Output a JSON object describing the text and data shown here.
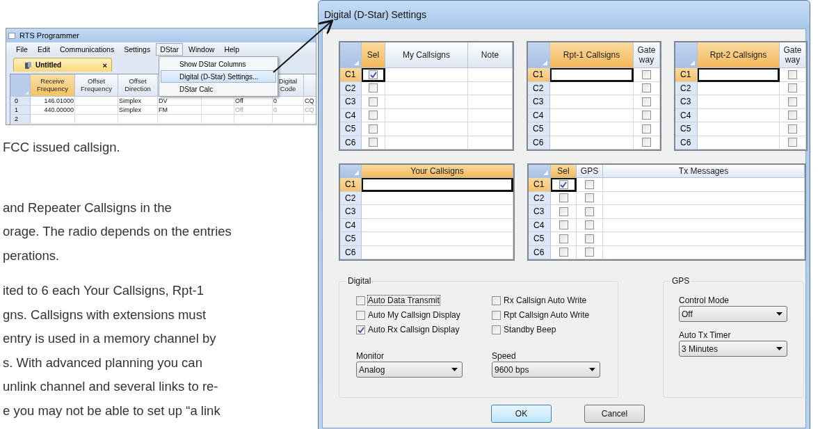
{
  "app_window": {
    "title": "RTS Programmer",
    "menu": [
      {
        "label": "File",
        "selected": false
      },
      {
        "label": "Edit",
        "selected": false
      },
      {
        "label": "Communications",
        "selected": false
      },
      {
        "label": "Settings",
        "selected": false
      },
      {
        "label": "DStar",
        "selected": true
      },
      {
        "label": "Window",
        "selected": false
      },
      {
        "label": "Help",
        "selected": false
      }
    ],
    "tab": {
      "label": "Untitled",
      "close": "×"
    },
    "dropdown": [
      {
        "label": "Show DStar Columns",
        "selected": false
      },
      {
        "label": "Digital (D-Star) Settings...",
        "selected": true
      },
      {
        "label": "DStar Calc",
        "selected": false
      }
    ],
    "grid": {
      "columns": [
        {
          "label": "Receive Frequency",
          "selected": true
        },
        {
          "label": "Offset Frequency",
          "selected": false
        },
        {
          "label": "Offset Direction",
          "selected": false
        },
        {},
        {},
        {},
        {
          "label": "Digital Code",
          "selected": false
        },
        {}
      ],
      "rows": [
        {
          "label": "0",
          "cells": [
            {
              "text": "146.01000",
              "disabled": false
            },
            null,
            {
              "text": "Simplex",
              "disabled": false
            },
            {
              "text": "DV",
              "disabled": false
            },
            null,
            {
              "text": "Off",
              "disabled": false
            },
            {
              "text": "0",
              "disabled": false
            },
            {
              "text": "CQ",
              "disabled": false
            }
          ]
        },
        {
          "label": "1",
          "cells": [
            {
              "text": "440.00000",
              "disabled": false
            },
            null,
            {
              "text": "Simplex",
              "disabled": false
            },
            {
              "text": "FM",
              "disabled": false
            },
            null,
            {
              "text": "Off",
              "disabled": true
            },
            {
              "text": "0",
              "disabled": true
            },
            {
              "text": "CQ",
              "disabled": true
            }
          ]
        },
        {
          "label": "2",
          "cells": []
        }
      ]
    }
  },
  "body_text": [
    [
      "FCC issued callsign."
    ],
    [
      "and Repeater Callsigns in the",
      "orage. The radio depends on the entries",
      "perations."
    ],
    [
      "ited to 6 each Your Callsigns, Rpt-1",
      "gns. Callsigns with extensions must",
      "entry is used in a memory channel by",
      "s. With advanced planning you can",
      "unlink channel and several links to re-",
      "e you may not be able to set up “a link"
    ]
  ],
  "dialog": {
    "title": "Digital (D-Star) Settings",
    "grids": [
      {
        "columns": [
          {
            "label": "Sel",
            "kind": "check",
            "selected": true
          },
          {
            "label": "My Callsigns",
            "kind": "text",
            "selected": false
          },
          {
            "label": "Note",
            "kind": "text",
            "selected": false
          }
        ],
        "rows": [
          {
            "label": "C1",
            "selected": true,
            "checked": [
              true
            ]
          },
          {
            "label": "C2",
            "selected": false,
            "checked": [
              false
            ]
          },
          {
            "label": "C3",
            "selected": false,
            "checked": [
              false
            ]
          },
          {
            "label": "C4",
            "selected": false,
            "checked": [
              false
            ]
          },
          {
            "label": "C5",
            "selected": false,
            "checked": [
              false
            ]
          },
          {
            "label": "C6",
            "selected": false,
            "checked": [
              false
            ]
          }
        ]
      },
      {
        "columns": [
          {
            "label": "Rpt-1 Callsigns",
            "kind": "text",
            "selected": true
          },
          {
            "label": "Gate way",
            "kind": "check",
            "selected": false
          }
        ],
        "rows": [
          {
            "label": "C1",
            "selected": true,
            "checked": [
              false
            ]
          },
          {
            "label": "C2",
            "selected": false,
            "checked": [
              false
            ]
          },
          {
            "label": "C3",
            "selected": false,
            "checked": [
              false
            ]
          },
          {
            "label": "C4",
            "selected": false,
            "checked": [
              false
            ]
          },
          {
            "label": "C5",
            "selected": false,
            "checked": [
              false
            ]
          },
          {
            "label": "C6",
            "selected": false,
            "checked": [
              false
            ]
          }
        ]
      },
      {
        "columns": [
          {
            "label": "Rpt-2 Callsigns",
            "kind": "text",
            "selected": true
          },
          {
            "label": "Gate way",
            "kind": "check",
            "selected": false
          }
        ],
        "rows": [
          {
            "label": "C1",
            "selected": true,
            "checked": [
              false
            ]
          },
          {
            "label": "C2",
            "selected": false,
            "checked": [
              false
            ]
          },
          {
            "label": "C3",
            "selected": false,
            "checked": [
              false
            ]
          },
          {
            "label": "C4",
            "selected": false,
            "checked": [
              false
            ]
          },
          {
            "label": "C5",
            "selected": false,
            "checked": [
              false
            ]
          },
          {
            "label": "C6",
            "selected": false,
            "checked": [
              false
            ]
          }
        ]
      },
      {
        "columns": [
          {
            "label": "Your Callsigns",
            "kind": "text",
            "selected": true
          }
        ],
        "rows": [
          {
            "label": "C1",
            "selected": true
          },
          {
            "label": "C2",
            "selected": false
          },
          {
            "label": "C3",
            "selected": false
          },
          {
            "label": "C4",
            "selected": false
          },
          {
            "label": "C5",
            "selected": false
          },
          {
            "label": "C6",
            "selected": false
          }
        ]
      },
      {
        "columns": [
          {
            "label": "Sel",
            "kind": "check",
            "selected": true
          },
          {
            "label": "GPS",
            "kind": "check",
            "selected": false
          },
          {
            "label": "Tx Messages",
            "kind": "text",
            "selected": false
          }
        ],
        "rows": [
          {
            "label": "C1",
            "selected": true,
            "checked": [
              true,
              false
            ]
          },
          {
            "label": "C2",
            "selected": false,
            "checked": [
              false,
              false
            ]
          },
          {
            "label": "C3",
            "selected": false,
            "checked": [
              false,
              false
            ]
          },
          {
            "label": "C4",
            "selected": false,
            "checked": [
              false,
              false
            ]
          },
          {
            "label": "C5",
            "selected": false,
            "checked": [
              false,
              false
            ]
          },
          {
            "label": "C6",
            "selected": false,
            "checked": [
              false,
              false
            ]
          }
        ]
      }
    ],
    "digital": {
      "legend": "Digital",
      "options": [
        {
          "label": "Auto Data Transmit",
          "checked": false,
          "focused": true
        },
        {
          "label": "Rx Callsign Auto Write",
          "checked": false,
          "focused": false
        },
        {
          "label": "Auto My Callsign Display",
          "checked": false,
          "focused": false
        },
        {
          "label": "Rpt Callsign Auto Write",
          "checked": false,
          "focused": false
        },
        {
          "label": "Auto Rx Callsign Display",
          "checked": true,
          "focused": false
        },
        {
          "label": "Standby Beep",
          "checked": false,
          "focused": false
        }
      ],
      "selects": [
        {
          "label": "Monitor",
          "value": "Analog"
        },
        {
          "label": "Speed",
          "value": "9600 bps"
        }
      ]
    },
    "gps": {
      "legend": "GPS",
      "selects": [
        {
          "label": "Control Mode",
          "value": "Off"
        },
        {
          "label": "Auto Tx Timer",
          "value": "3 Minutes"
        }
      ]
    },
    "buttons": [
      {
        "label": "OK",
        "default": true
      },
      {
        "label": "Cancel",
        "default": false
      }
    ]
  }
}
